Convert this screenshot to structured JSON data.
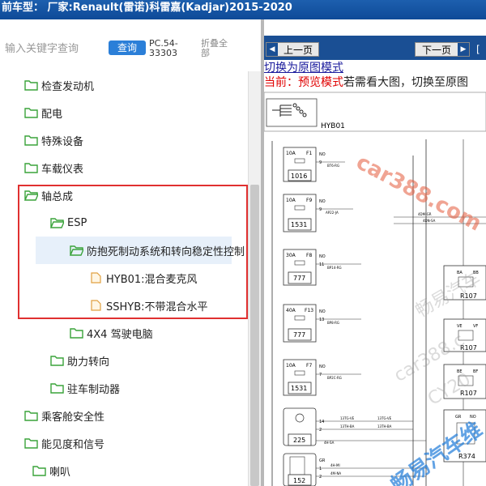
{
  "topbar": {
    "prefix": "前车型：",
    "make": "厂家:Renault(雷诺)科雷嘉(Kadjar)2015-2020"
  },
  "search": {
    "placeholder": "输入关键字查询",
    "button": "查询",
    "pc_code_1": "PC.54-",
    "pc_code_2": "33303",
    "collapse_1": "折叠全",
    "collapse_2": "部"
  },
  "tree": [
    {
      "label": "检查发动机",
      "icon": "folder-icon"
    },
    {
      "label": "配电",
      "icon": "folder-icon"
    },
    {
      "label": "特殊设备",
      "icon": "folder-icon"
    },
    {
      "label": "车载仪表",
      "icon": "folder-icon"
    },
    {
      "label": "轴总成",
      "icon": "folder-open-icon"
    },
    {
      "label": "ESP",
      "icon": "folder-open-icon"
    },
    {
      "label": "防抱死制动系统和转向稳定性控制",
      "icon": "folder-open-icon"
    },
    {
      "label": "HYB01:混合麦克风",
      "icon": "file-icon"
    },
    {
      "label": "SSHYB:不带混合水平",
      "icon": "file-icon"
    },
    {
      "label": "4X4 驾驶电脑",
      "icon": "folder-icon"
    },
    {
      "label": "助力转向",
      "icon": "folder-icon"
    },
    {
      "label": "驻车制动器",
      "icon": "folder-icon"
    },
    {
      "label": "乘客舱安全性",
      "icon": "folder-icon"
    },
    {
      "label": "能见度和信号",
      "icon": "folder-icon"
    },
    {
      "label": "喇叭",
      "icon": "folder-icon"
    }
  ],
  "viewer": {
    "prev": "上一页",
    "next": "下一页",
    "extra": "[",
    "switch_link": "切换为原图模式",
    "mode_label": "当前：",
    "mode_value": "预览模式",
    "mode_hint": "若需看大图，切换至原图"
  },
  "diagram": {
    "header_code": "HYB01",
    "fuses": [
      {
        "amp": "10A",
        "id": "F1",
        "box": "1016",
        "wire": "BT6-RG"
      },
      {
        "amp": "10A",
        "id": "F9",
        "box": "1531",
        "wire": "AP22-JA"
      },
      {
        "amp": "30A",
        "id": "F8",
        "box": "777",
        "wire": "BP14-RG"
      },
      {
        "amp": "40A",
        "id": "F13",
        "box": "777",
        "wire": "BP8-RG"
      },
      {
        "amp": "10A",
        "id": "F7",
        "box": "1531",
        "wire": "BP2C-RG"
      }
    ],
    "relays": [
      "R107",
      "R107",
      "R107",
      "R374"
    ],
    "relay_pins": [
      "BA",
      "BB",
      "VE",
      "VF",
      "BE",
      "BF",
      "GR",
      "NO"
    ],
    "component_225": "225",
    "component_152": "152",
    "pins_225": [
      "14",
      "2"
    ],
    "wires_225": [
      "13TG-VE",
      "13TH-BA"
    ],
    "pins_152": [
      "GR",
      "1",
      "2"
    ],
    "wires_right": [
      "4DM-GR",
      "4DN-SA"
    ],
    "no_labels": [
      "NO",
      "NO",
      "NO",
      "NO",
      "NO",
      "NO"
    ],
    "pin_numbers": [
      "9",
      "9",
      "11",
      "13",
      "7"
    ],
    "wire_4hsa": "4H-SA",
    "small_wires": [
      "4H-MI",
      "4M-NA"
    ]
  },
  "watermarks": [
    "car388.com",
    "畅易汽车",
    "car388.c",
    "CY20",
    "畅易汽车维"
  ],
  "colors": {
    "topbar": "#1d5fae",
    "navbar": "#1a4f94",
    "highlight": "#e03030",
    "button": "#2b7fd8"
  }
}
